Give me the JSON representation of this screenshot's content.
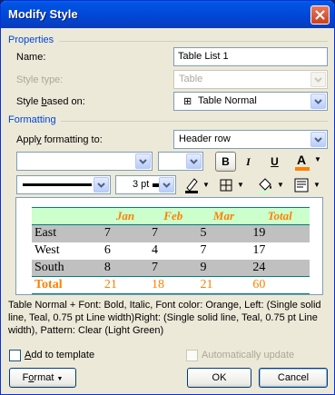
{
  "window": {
    "title": "Modify Style"
  },
  "properties": {
    "section_label": "Properties",
    "name_label": "Name:",
    "name_value": "Table List 1",
    "style_type_label": "Style type:",
    "style_type_value": "Table",
    "based_on_label": "Style based on:",
    "based_on_value": "Table Normal"
  },
  "formatting": {
    "section_label": "Formatting",
    "apply_label": "Apply formatting to:",
    "apply_value": "Header row",
    "font_value": "",
    "size_value": "",
    "bold": "B",
    "italic": "I",
    "underline": "U",
    "font_color_glyph": "A",
    "line_weight": "3 pt"
  },
  "preview": {
    "headers": [
      "",
      "Jan",
      "Feb",
      "Mar",
      "Total"
    ],
    "rows": [
      [
        "East",
        "7",
        "7",
        "5",
        "19"
      ],
      [
        "West",
        "6",
        "4",
        "7",
        "17"
      ],
      [
        "South",
        "8",
        "7",
        "9",
        "24"
      ]
    ],
    "total": [
      "Total",
      "21",
      "18",
      "21",
      "60"
    ],
    "colors": {
      "header_bg": "#ccffcc",
      "accent": "#ff8000",
      "border": "#008080",
      "band": "#c0c0c0"
    }
  },
  "description": "Table Normal + Font: Bold, Italic, Font color: Orange, Left: (Single solid line, Teal,  0.75 pt Line width)Right: (Single solid line, Teal,  0.75 pt Line width), Pattern: Clear (Light Green)",
  "options": {
    "add_to_template": "Add to template",
    "auto_update": "Automatically update"
  },
  "buttons": {
    "format": "Format",
    "ok": "OK",
    "cancel": "Cancel"
  }
}
